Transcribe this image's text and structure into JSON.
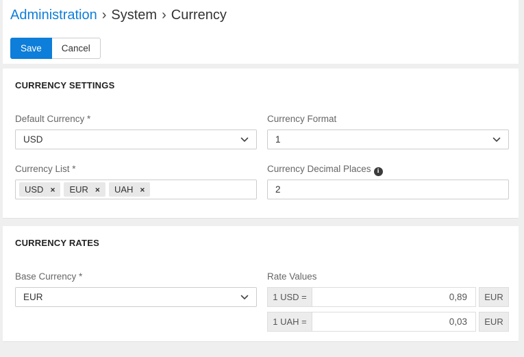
{
  "breadcrumb": {
    "root": "Administration",
    "separator": "›",
    "level1": "System",
    "level2": "Currency"
  },
  "toolbar": {
    "save": "Save",
    "cancel": "Cancel"
  },
  "icons": {
    "info": "i",
    "remove_tag": "×"
  },
  "colors": {
    "primary": "#0d7ed9"
  },
  "settings_section": {
    "title": "CURRENCY SETTINGS",
    "default_currency": {
      "label": "Default Currency *",
      "value": "USD"
    },
    "currency_format": {
      "label": "Currency Format",
      "value": "1"
    },
    "currency_list": {
      "label": "Currency List *",
      "tags": [
        "USD",
        "EUR",
        "UAH"
      ]
    },
    "decimal_places": {
      "label": "Currency Decimal Places",
      "value": "2"
    }
  },
  "rates_section": {
    "title": "CURRENCY RATES",
    "base_currency": {
      "label": "Base Currency *",
      "value": "EUR"
    },
    "rate_values": {
      "label": "Rate Values",
      "rows": [
        {
          "prefix": "1 USD =",
          "value": "0,89",
          "suffix": "EUR"
        },
        {
          "prefix": "1 UAH =",
          "value": "0,03",
          "suffix": "EUR"
        }
      ]
    }
  }
}
